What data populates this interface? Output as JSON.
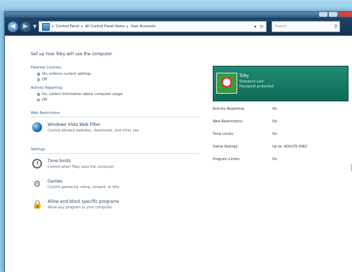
{
  "window": {
    "address_crumbs": [
      "Control Panel",
      "All Control Panel Items",
      "User Accounts"
    ],
    "search_placeholder": "Search"
  },
  "page": {
    "title": "Set up how Toby will use the computer"
  },
  "sections": {
    "parental_controls": {
      "heading": "Parental Controls:",
      "options": [
        "On, enforce current settings",
        "Off"
      ],
      "selected": 0
    },
    "activity_reporting": {
      "heading": "Activity Reporting:",
      "options": [
        "On, collect information about computer usage",
        "Off"
      ],
      "selected": 0
    },
    "web_restrictions": {
      "heading": "Web Restrictions",
      "items": [
        {
          "title": "Windows Vista Web Filter",
          "desc": "Control allowed websites, downloads, and other use",
          "icon": "globe-icon"
        }
      ]
    },
    "settings": {
      "heading": "Settings",
      "items": [
        {
          "title": "Time limits",
          "desc": "Control when Toby uses the computer",
          "icon": "clock-icon"
        },
        {
          "title": "Games",
          "desc": "Control games by rating, content, or title",
          "icon": "gear-icon"
        },
        {
          "title": "Allow and block specific programs",
          "desc": "Allow any program or your computer",
          "icon": "lock-icon"
        }
      ]
    }
  },
  "user_card": {
    "name": "Toby",
    "account_type": "Standard user",
    "password_status": "Password protected"
  },
  "current_settings": [
    {
      "label": "Activity Reporting:",
      "value": "On"
    },
    {
      "label": "Web Restrictions:",
      "value": "On"
    },
    {
      "label": "Time Limits:",
      "value": "On"
    },
    {
      "label": "Game Ratings:",
      "value": "Up to: ADULTS ONLY"
    },
    {
      "label": "Program Limits:",
      "value": "On"
    }
  ]
}
